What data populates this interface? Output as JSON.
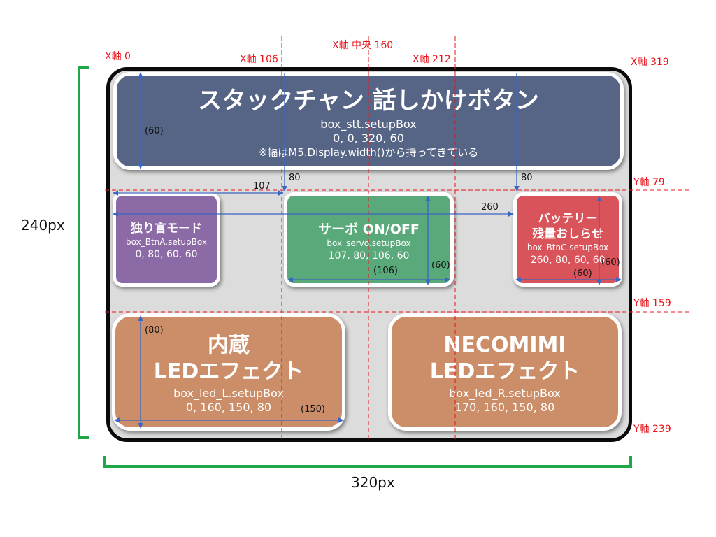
{
  "axis_labels": {
    "x0": "X軸 0",
    "x106": "X軸 106",
    "x_center": "X軸 中央 160",
    "x212": "X軸 212",
    "x319": "X軸 319",
    "y79": "Y軸 79",
    "y159": "Y軸 159",
    "y239": "Y軸 239"
  },
  "screen": {
    "height_label": "240px",
    "width_label": "320px"
  },
  "boxes": {
    "stt": {
      "title": "スタックチャン 話しかけボタン",
      "func": "box_stt.setupBox",
      "coords": "0, 0, 320, 60",
      "note": "※幅はM5.Display.width()から持ってきている",
      "color": "#566585"
    },
    "btnA": {
      "title": "独り言モード",
      "func": "box_BtnA.setupBox",
      "coords": "0, 80, 60, 60",
      "color": "#8c6aa5"
    },
    "servo": {
      "title": "サーボ ON/OFF",
      "func": "box_servo.setupBox",
      "coords": "107, 80, 106, 60",
      "color": "#5aa97a"
    },
    "btnC": {
      "title_line1": "バッテリー",
      "title_line2": "残量おしらせ",
      "func": "box_BtnC.setupBox",
      "coords": "260, 80, 60, 60",
      "color": "#d9535a"
    },
    "led_L": {
      "title_line1": "内蔵",
      "title_line2": "LEDエフェクト",
      "func": "box_led_L.setupBox",
      "coords": "0, 160, 150, 80",
      "color": "#cc8e68"
    },
    "led_R": {
      "title_line1": "NECOMIMI",
      "title_line2": "LEDエフェクト",
      "func": "box_led_R.setupBox",
      "coords": "170, 160, 150, 80",
      "color": "#cc8e68"
    }
  },
  "dimensions": {
    "stt_height": "(60)",
    "arrow_80_left": "80",
    "arrow_80_right": "80",
    "x107": "107",
    "x260": "260",
    "servo_width": "(106)",
    "servo_height": "(60)",
    "btnC_height": "(60)",
    "btnC_width": "(60)",
    "ledL_height": "(80)",
    "ledL_width": "(150)"
  }
}
